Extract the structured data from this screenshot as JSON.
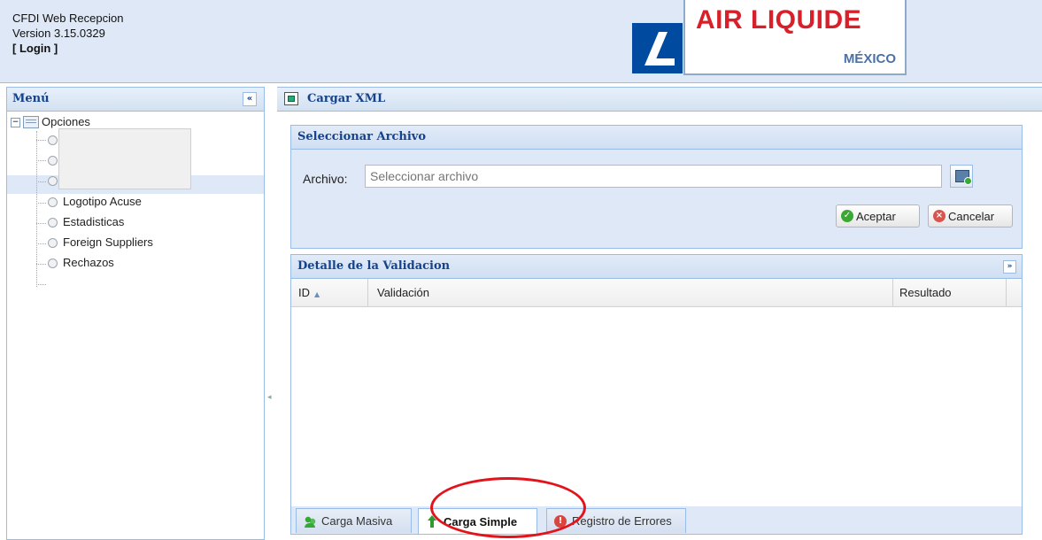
{
  "app": {
    "title": "CFDI Web Recepcion",
    "version": "Version 3.15.0329",
    "login": "[ Login ]"
  },
  "brand": {
    "name": "AIR LIQUIDE",
    "country": "MÉXICO",
    "primary_color": "#d8202a",
    "mark_color": "#004aa0"
  },
  "menu": {
    "title": "Menú",
    "collapse_icon": "double-chevron-left-icon",
    "root": "Opciones",
    "items": [
      {
        "label": "Logotipo Acuse"
      },
      {
        "label": "Estadisticas"
      },
      {
        "label": "Foreign Suppliers"
      },
      {
        "label": "Rechazos"
      }
    ]
  },
  "main": {
    "title": "Cargar XML",
    "file_section": {
      "title": "Seleccionar Archivo",
      "label": "Archivo:",
      "placeholder": "Seleccionar archivo",
      "accept": "Aceptar",
      "cancel": "Cancelar"
    },
    "validation": {
      "title": "Detalle de la Validacion",
      "columns": [
        "ID",
        "Validación",
        "Resultado"
      ],
      "rows": []
    },
    "tabs": [
      {
        "label": "Carga Masiva",
        "active": false
      },
      {
        "label": "Carga Simple",
        "active": true
      },
      {
        "label": "Registro de Errores",
        "active": false
      }
    ]
  },
  "annotation_color": "#e3131b"
}
